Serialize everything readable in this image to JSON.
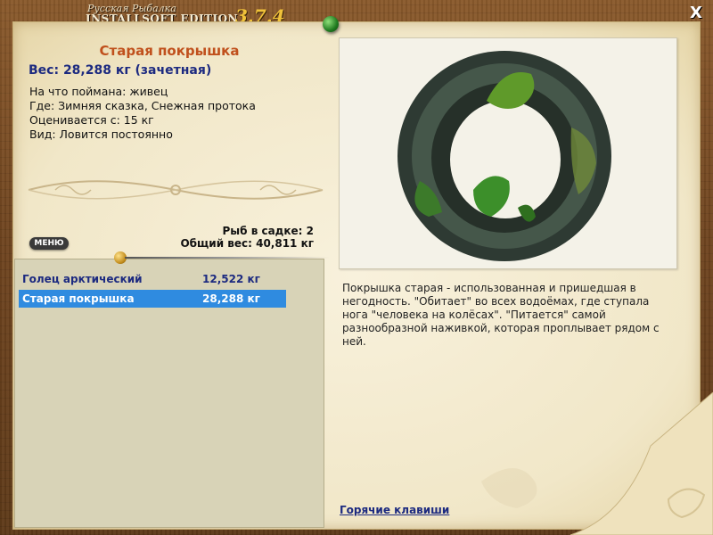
{
  "window": {
    "title_top": "Русская Рыбалка",
    "title_main": "INSTALLSOFT EDITION",
    "version": "3.7.4",
    "close_label": "X"
  },
  "fish": {
    "name": "Старая покрышка",
    "weight_line": "Вес: 28,288 кг (зачетная)",
    "caught_on": "На что поймана: живец",
    "location": "Где: Зимняя сказка, Снежная протока",
    "valued_from": "Оценивается с: 15 кг",
    "kind": "Вид: Ловится постоянно",
    "description": "Покрышка старая - использованная и пришедшая в негодность. \"Обитает\" во всех водоёмах, где ступала нога \"человека на колёсах\". \"Питается\" самой разнообразной наживкой, которая проплывает рядом с ней."
  },
  "stats": {
    "fish_in_keepnet": "Рыб в садке: 2",
    "total_weight": "Общий вес: 40,811 кг"
  },
  "menu_label": "МЕНЮ",
  "catch_list": [
    {
      "name": "Голец арктический",
      "weight": "12,522 кг",
      "selected": false
    },
    {
      "name": "Старая покрышка",
      "weight": "28,288 кг",
      "selected": true
    }
  ],
  "hotkeys_label": "Горячие клавиши",
  "colors": {
    "title_accent": "#c0501c",
    "weight_accent": "#1c2a80",
    "selection": "#2f8be0",
    "version": "#f0c23a"
  },
  "icons": [
    "close-icon",
    "pin-icon",
    "tire-image",
    "ornament-divider",
    "page-curl-icon"
  ]
}
